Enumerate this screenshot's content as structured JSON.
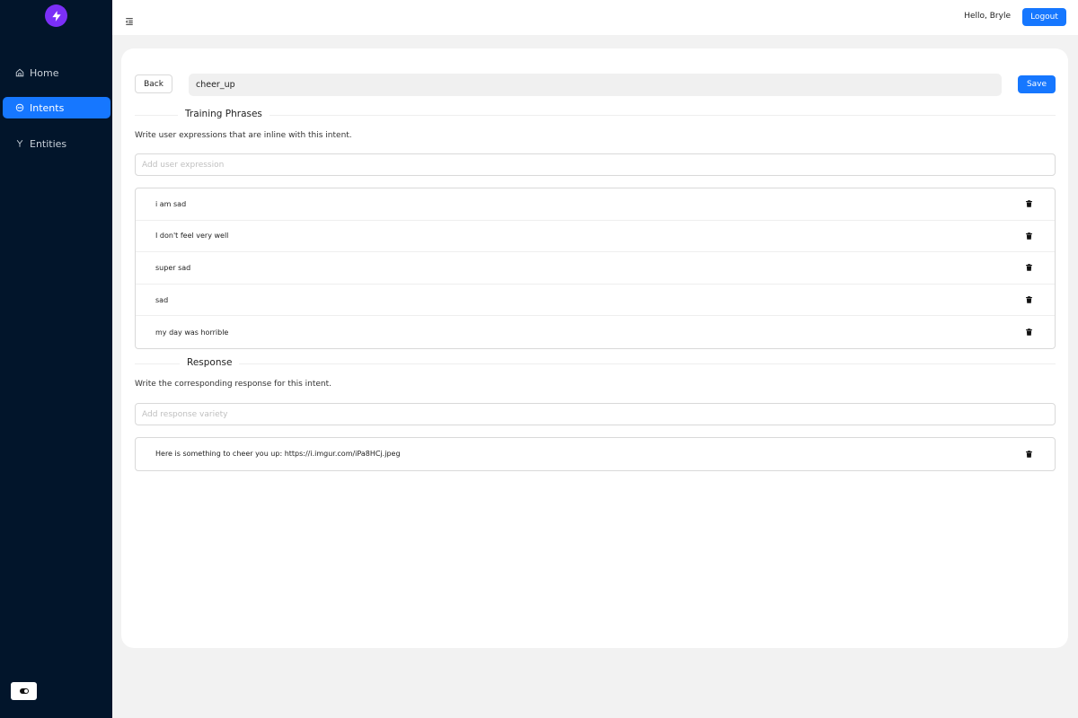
{
  "sidebar": {
    "logo_icon": "lightning-bolt-icon",
    "items": [
      {
        "label": "Home",
        "icon": "home-icon",
        "active": false
      },
      {
        "label": "Intents",
        "icon": "message-bubble-icon",
        "active": true
      },
      {
        "label": "Entities",
        "icon": "fork-icon",
        "active": false
      }
    ],
    "theme_toggle_icon": "toggle-icon"
  },
  "header": {
    "menu_icon": "menu-fold-icon",
    "greeting": "Hello, Bryle",
    "logout_label": "Logout"
  },
  "intent": {
    "back_label": "Back",
    "name": "cheer_up",
    "save_label": "Save"
  },
  "training": {
    "title": "Training Phrases",
    "description": "Write user expressions that are inline with this intent.",
    "placeholder": "Add user expression",
    "phrases": [
      "i am sad",
      "I don't feel very well",
      "super sad",
      "sad",
      "my day was horrible"
    ]
  },
  "response": {
    "title": "Response",
    "description": "Write the corresponding response for this intent.",
    "placeholder": "Add response variety",
    "items": [
      "Here is something to cheer you up: https://i.imgur.com/iPa8HCj.jpeg"
    ]
  },
  "colors": {
    "sidebar_bg": "#02152b",
    "accent": "#1677ff",
    "logo": "#7b2ff7"
  }
}
